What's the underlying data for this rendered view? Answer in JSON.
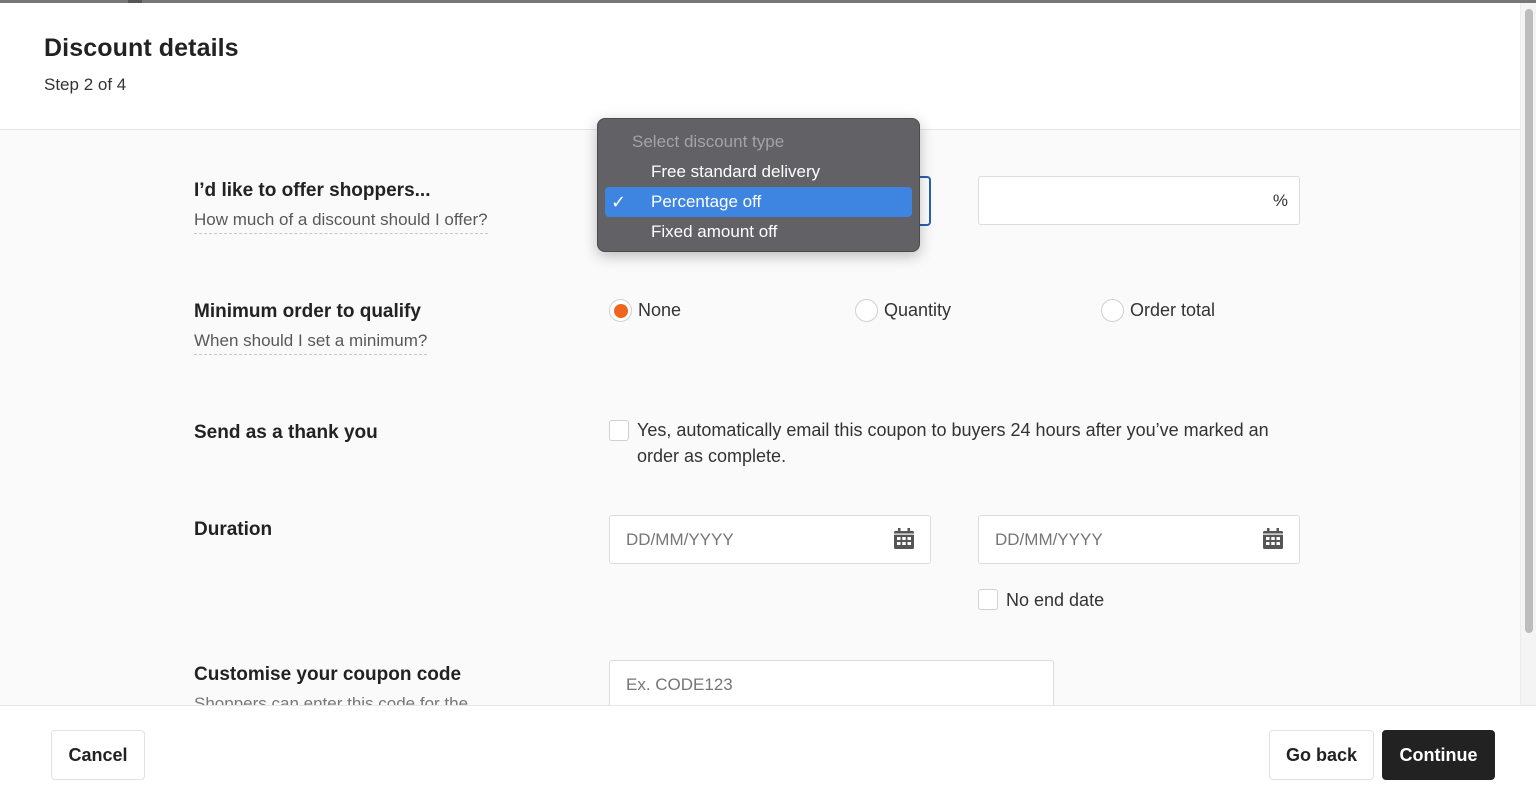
{
  "header": {
    "title": "Discount details",
    "step": "Step 2 of 4"
  },
  "offer": {
    "label": "I’d like to offer shoppers...",
    "help": "How much of a discount should I offer?",
    "discount_type_selected": "Percentage off",
    "percent_value": "",
    "percent_suffix": "%"
  },
  "dropdown": {
    "placeholder": "Select discount type",
    "options": [
      "Free standard delivery",
      "Percentage off",
      "Fixed amount off"
    ],
    "selected_index": 1,
    "check_glyph": "✓"
  },
  "minimum": {
    "label": "Minimum order to qualify",
    "help": "When should I set a minimum?",
    "options": [
      "None",
      "Quantity",
      "Order total"
    ],
    "selected": "None"
  },
  "thank_you": {
    "label": "Send as a thank you",
    "checkbox_text": "Yes, automatically email this coupon to buyers 24 hours after you’ve marked an order as complete.",
    "checked": false
  },
  "duration": {
    "label": "Duration",
    "start_placeholder": "DD/MM/YYYY",
    "end_placeholder": "DD/MM/YYYY",
    "no_end_date_label": "No end date",
    "no_end_date_checked": false
  },
  "coupon": {
    "label": "Customise your coupon code",
    "help": "Shoppers can enter this code for the",
    "placeholder": "Ex. CODE123"
  },
  "footer": {
    "cancel": "Cancel",
    "go_back": "Go back",
    "continue": "Continue"
  },
  "colors": {
    "accent_radio": "#f1641e",
    "dropdown_selected": "#3d85e0",
    "primary_button": "#222222",
    "focus_border": "#2b5fb5"
  }
}
